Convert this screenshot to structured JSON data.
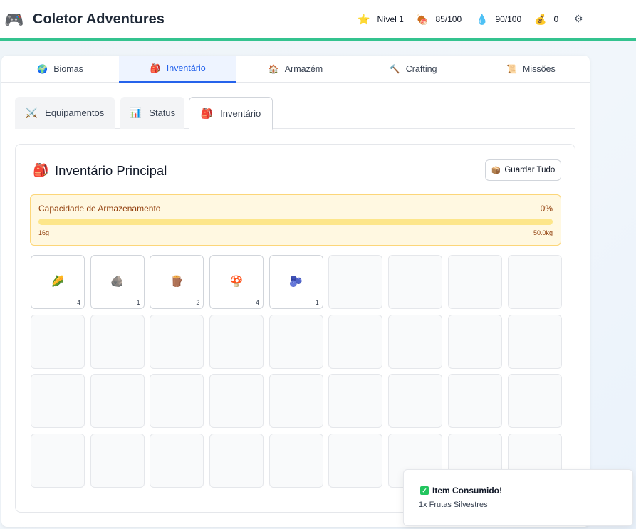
{
  "header": {
    "logo_icon": "🎮",
    "title": "Coletor Adventures",
    "stats": {
      "level": {
        "icon": "⭐",
        "icon_name": "star-icon",
        "label": "Nível 1"
      },
      "food": {
        "icon": "🍖",
        "icon_name": "meat-icon",
        "label": "85/100"
      },
      "water": {
        "icon": "💧",
        "icon_name": "water-drop-icon",
        "label": "90/100"
      },
      "coins": {
        "icon": "💰",
        "icon_name": "money-bag-icon",
        "label": "0"
      }
    },
    "settings_icon": "⚙"
  },
  "main_tabs": [
    {
      "icon": "🌍",
      "label": "Biomas"
    },
    {
      "icon": "🎒",
      "label": "Inventário",
      "active": true
    },
    {
      "icon": "🏠",
      "label": "Armazém"
    },
    {
      "icon": "🔨",
      "label": "Crafting"
    },
    {
      "icon": "📜",
      "label": "Missões"
    }
  ],
  "sub_tabs": [
    {
      "icon": "⚔️",
      "label": "Equipamentos"
    },
    {
      "icon": "📊",
      "label": "Status"
    },
    {
      "icon": "🎒",
      "label": "Inventário",
      "active": true
    }
  ],
  "inventory": {
    "title_icon": "🎒",
    "title": "Inventário Principal",
    "store_all": {
      "icon": "📦",
      "label": "Guardar Tudo"
    },
    "capacity": {
      "label": "Capacidade de Armazenamento",
      "percent_label": "0%",
      "fill_fraction": 0.0,
      "min_label": "16g",
      "max_label": "50.0kg"
    },
    "slots": [
      {
        "icon": "🌽",
        "icon_name": "corn-icon",
        "qty": "4"
      },
      {
        "icon": "🪨",
        "icon_name": "stone-icon",
        "qty": "1"
      },
      {
        "icon": "🪵",
        "icon_name": "wood-log-icon",
        "qty": "2"
      },
      {
        "icon": "🍄",
        "icon_name": "mushroom-icon",
        "qty": "4"
      },
      {
        "icon": "🫐",
        "icon_name": "berries-icon",
        "qty": "1"
      },
      {},
      {},
      {},
      {},
      {},
      {},
      {},
      {},
      {},
      {},
      {},
      {},
      {},
      {},
      {},
      {},
      {},
      {},
      {},
      {},
      {},
      {},
      {},
      {},
      {},
      {},
      {},
      {},
      {},
      {},
      {}
    ]
  },
  "toast": {
    "check_icon": "✓",
    "title": "Item Consumido!",
    "message": "1x Frutas Silvestres"
  },
  "colors": {
    "accent": "#2563eb",
    "header_border": "#34c38f",
    "capacity_bg": "#fff8e1",
    "capacity_bar": "#fde68a",
    "success": "#22c55e"
  }
}
